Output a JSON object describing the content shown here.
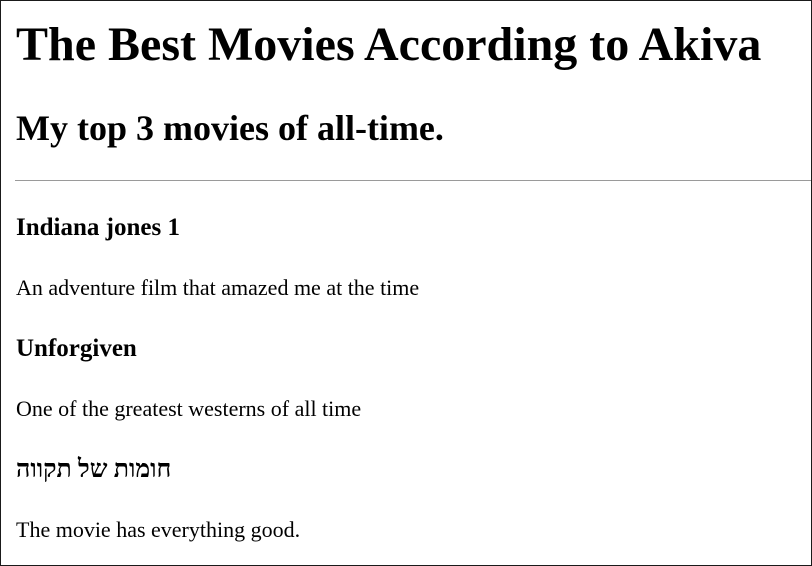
{
  "page": {
    "title": "The Best Movies According to Akiva",
    "subtitle": "My top 3 movies of all-time."
  },
  "movies": [
    {
      "title": "Indiana jones 1",
      "description": "An adventure film that amazed me at the time"
    },
    {
      "title": "Unforgiven",
      "description": "One of the greatest westerns of all time"
    },
    {
      "title": "חומות של תקווה",
      "description": "The movie has everything good."
    }
  ]
}
